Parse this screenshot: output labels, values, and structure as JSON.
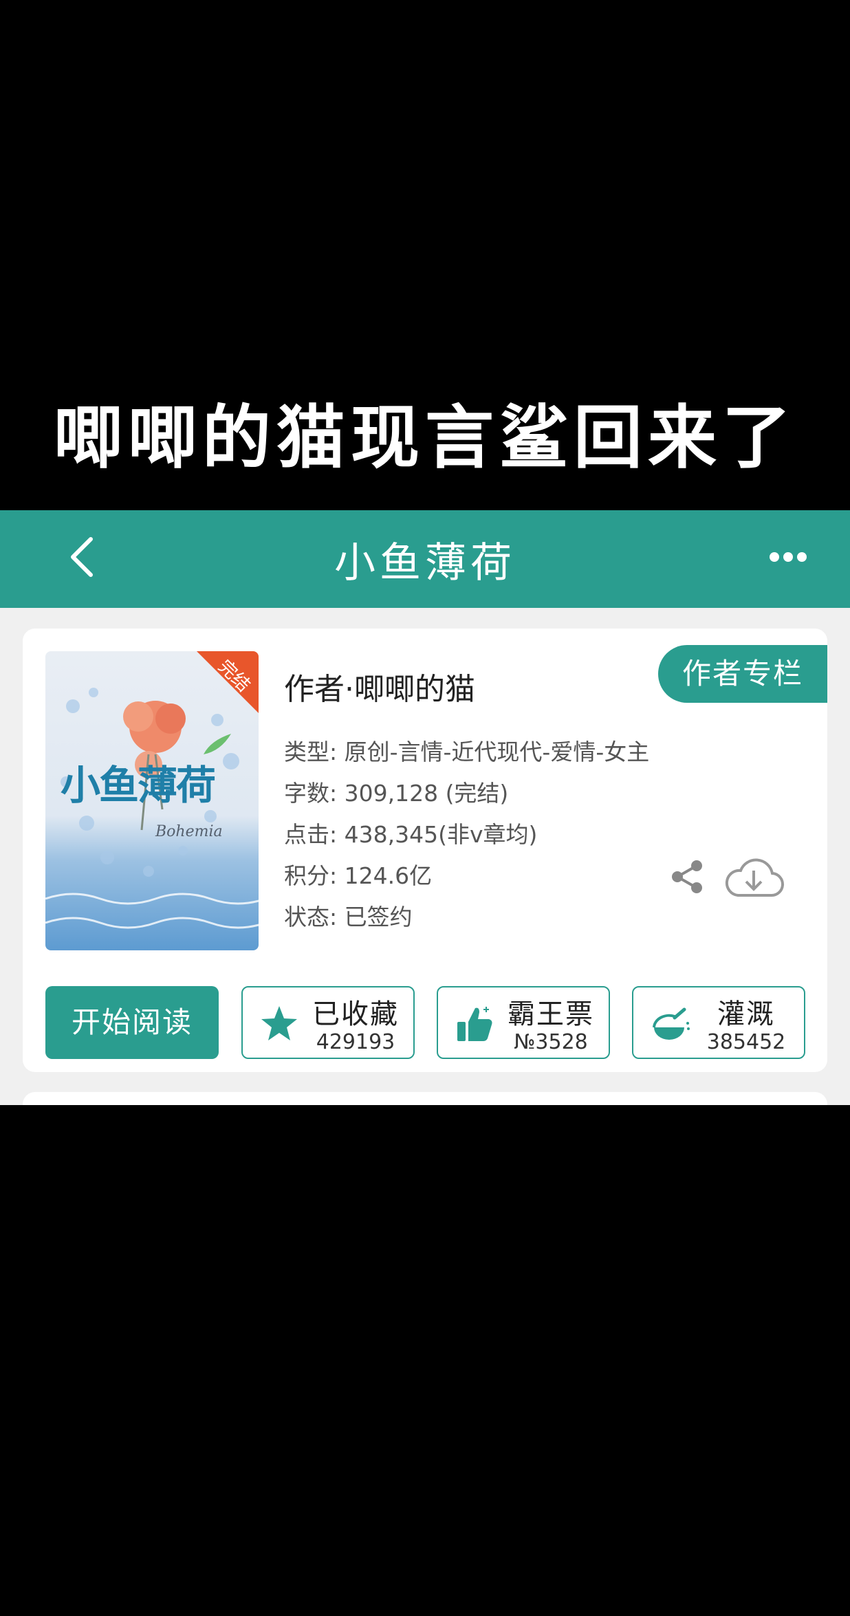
{
  "overlay": {
    "title": "唧唧的猫现言鲨回来了"
  },
  "navbar": {
    "back_icon": "chevron-left-icon",
    "title": "小鱼薄荷",
    "more_icon": "more-dots-icon"
  },
  "book": {
    "cover": {
      "title": "小鱼薄荷",
      "badge": "完结",
      "signature": "Bohemia"
    },
    "author_line": "作者·唧唧的猫",
    "author_column_label": "作者专栏",
    "info": [
      {
        "label": "类型",
        "value": "原创-言情-近代现代-爱情-女主"
      },
      {
        "label": "字数",
        "value": "309,128 (完结)"
      },
      {
        "label": "点击",
        "value": "438,345(非v章均)"
      },
      {
        "label": "积分",
        "value": "124.6亿"
      },
      {
        "label": "状态",
        "value": "已签约"
      }
    ],
    "share_icon": "share-icon",
    "download_icon": "cloud-download-icon"
  },
  "actions": {
    "read_label": "开始阅读",
    "stats": [
      {
        "icon": "star-icon",
        "label": "已收藏",
        "value": "429193"
      },
      {
        "icon": "thumbs-up-icon",
        "label": "霸王票",
        "value": "№3528"
      },
      {
        "icon": "watering-can-icon",
        "label": "灌溉",
        "value": "385452"
      }
    ]
  },
  "colors": {
    "accent": "#2a9d8f",
    "background": "#f0f0f0",
    "overlay_background": "#000000",
    "badge": "#e8562b"
  }
}
